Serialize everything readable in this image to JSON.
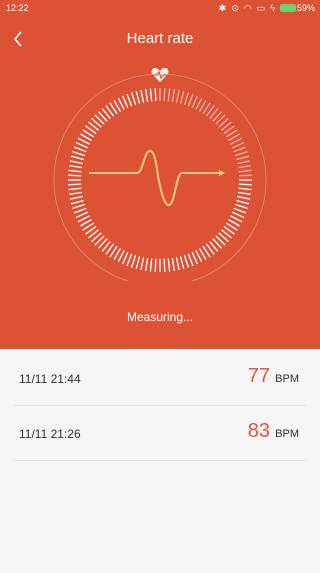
{
  "status_bar": {
    "time": "12:22",
    "battery_percent": "59%",
    "battery_color": "#6bd36b",
    "icons": [
      "bluetooth-icon",
      "alarm-icon",
      "wifi-icon",
      "sim-icon",
      "charging-icon",
      "battery-icon"
    ]
  },
  "header": {
    "title": "Heart rate",
    "back_icon": "chevron-left-icon"
  },
  "gauge": {
    "heart_icon": "heart-pulse-icon",
    "status": "Measuring..."
  },
  "history": [
    {
      "datetime": "11/11 21:44",
      "bpm": "77",
      "unit": "BPM"
    },
    {
      "datetime": "11/11 21:26",
      "bpm": "83",
      "unit": "BPM"
    }
  ],
  "colors": {
    "header_bg": "#dc5234",
    "accent": "#e5553a",
    "waveform": "#f6c97a"
  }
}
